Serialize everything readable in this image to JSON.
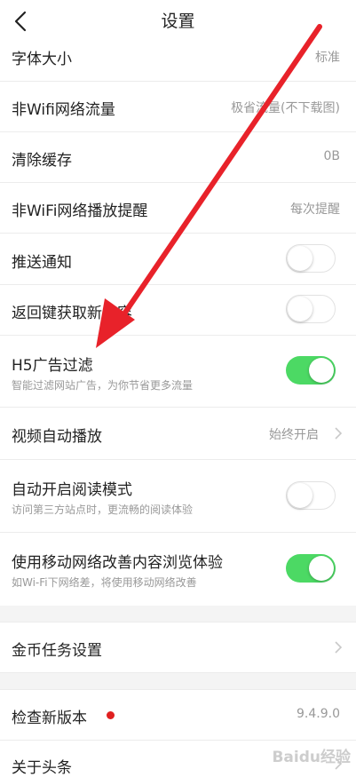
{
  "header": {
    "title": "设置"
  },
  "settings": {
    "font_size": {
      "label": "字体大小",
      "value": "标准"
    },
    "wifi_traffic": {
      "label": "非Wifi网络流量",
      "value": "极省流量(不下载图)"
    },
    "clear_cache": {
      "label": "清除缓存",
      "value": "0B"
    },
    "wifi_play_reminder": {
      "label": "非WiFi网络播放提醒",
      "value": "每次提醒"
    },
    "push": {
      "label": "推送通知",
      "enabled": false
    },
    "back_refresh": {
      "label": "返回键获取新内容",
      "enabled": false
    },
    "h5_ad_filter": {
      "label": "H5广告过滤",
      "sub": "智能过滤网站广告，为你节省更多流量",
      "enabled": true
    },
    "video_autoplay": {
      "label": "视频自动播放",
      "value": "始终开启"
    },
    "auto_reader": {
      "label": "自动开启阅读模式",
      "sub": "访问第三方站点时，更流畅的阅读体验",
      "enabled": false
    },
    "mobile_net_improve": {
      "label": "使用移动网络改善内容浏览体验",
      "sub": "如Wi-Fi下网络差，将使用移动网络改善",
      "enabled": true
    },
    "coin_tasks": {
      "label": "金币任务设置"
    },
    "check_update": {
      "label": "检查新版本",
      "value": "9.4.9.0"
    },
    "about": {
      "label": "关于头条"
    }
  },
  "watermark": {
    "text": "Baidu经验"
  },
  "colors": {
    "toggle_on": "#4cd964",
    "annotation_arrow": "#e8222a",
    "update_dot": "#e02020"
  }
}
